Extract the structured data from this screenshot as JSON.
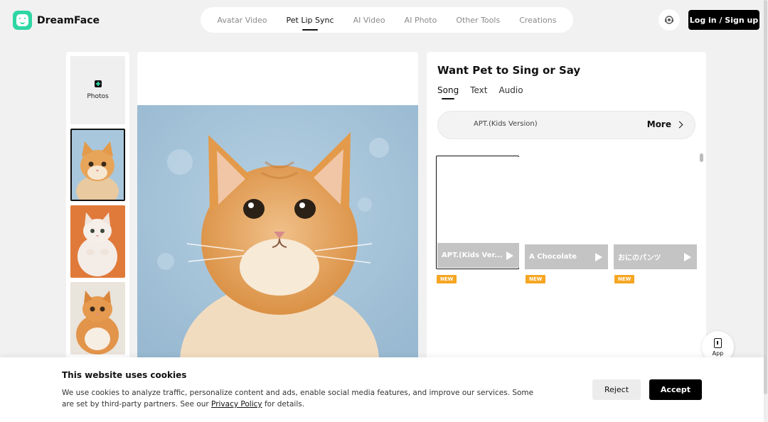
{
  "brand": {
    "name": "DreamFace",
    "accent": "#2ed6a3"
  },
  "nav": {
    "items": [
      {
        "label": "Avatar Video",
        "active": false
      },
      {
        "label": "Pet Lip Sync",
        "active": true
      },
      {
        "label": "AI Video",
        "active": false
      },
      {
        "label": "AI Photo",
        "active": false
      },
      {
        "label": "Other Tools",
        "active": false
      },
      {
        "label": "Creations",
        "active": false
      }
    ]
  },
  "header": {
    "login_label": "Log in / Sign up",
    "support_icon": "headset-icon"
  },
  "sidebar": {
    "upload_label": "Photos",
    "thumbnails": [
      {
        "icon": "cat-photo",
        "selected": true
      },
      {
        "icon": "cat-photo",
        "selected": false
      },
      {
        "icon": "cat-photo",
        "selected": false
      }
    ]
  },
  "panel": {
    "title": "Want Pet to Sing or Say",
    "tabs": [
      {
        "label": "Song",
        "active": true
      },
      {
        "label": "Text",
        "active": false
      },
      {
        "label": "Audio",
        "active": false
      }
    ],
    "current_song": "APT.(Kids Version)",
    "more_label": "More",
    "songs": [
      {
        "name": "APT.(Kids Ver...",
        "badge": "NEW",
        "selected": true
      },
      {
        "name": "A Chocolate",
        "badge": "NEW",
        "selected": false
      },
      {
        "name": "おにのパンツ",
        "badge": "NEW",
        "selected": false
      }
    ],
    "badge_color": "#f5a623"
  },
  "app_button": {
    "label": "App"
  },
  "cookie": {
    "title": "This website uses cookies",
    "text_before": "We use cookies to analyze traffic, personalize content and ads, enable social media features, and improve our services. Some are set by third-party partners. See our ",
    "link": "Privacy Policy",
    "text_after": " for details.",
    "reject_label": "Reject",
    "accept_label": "Accept"
  }
}
